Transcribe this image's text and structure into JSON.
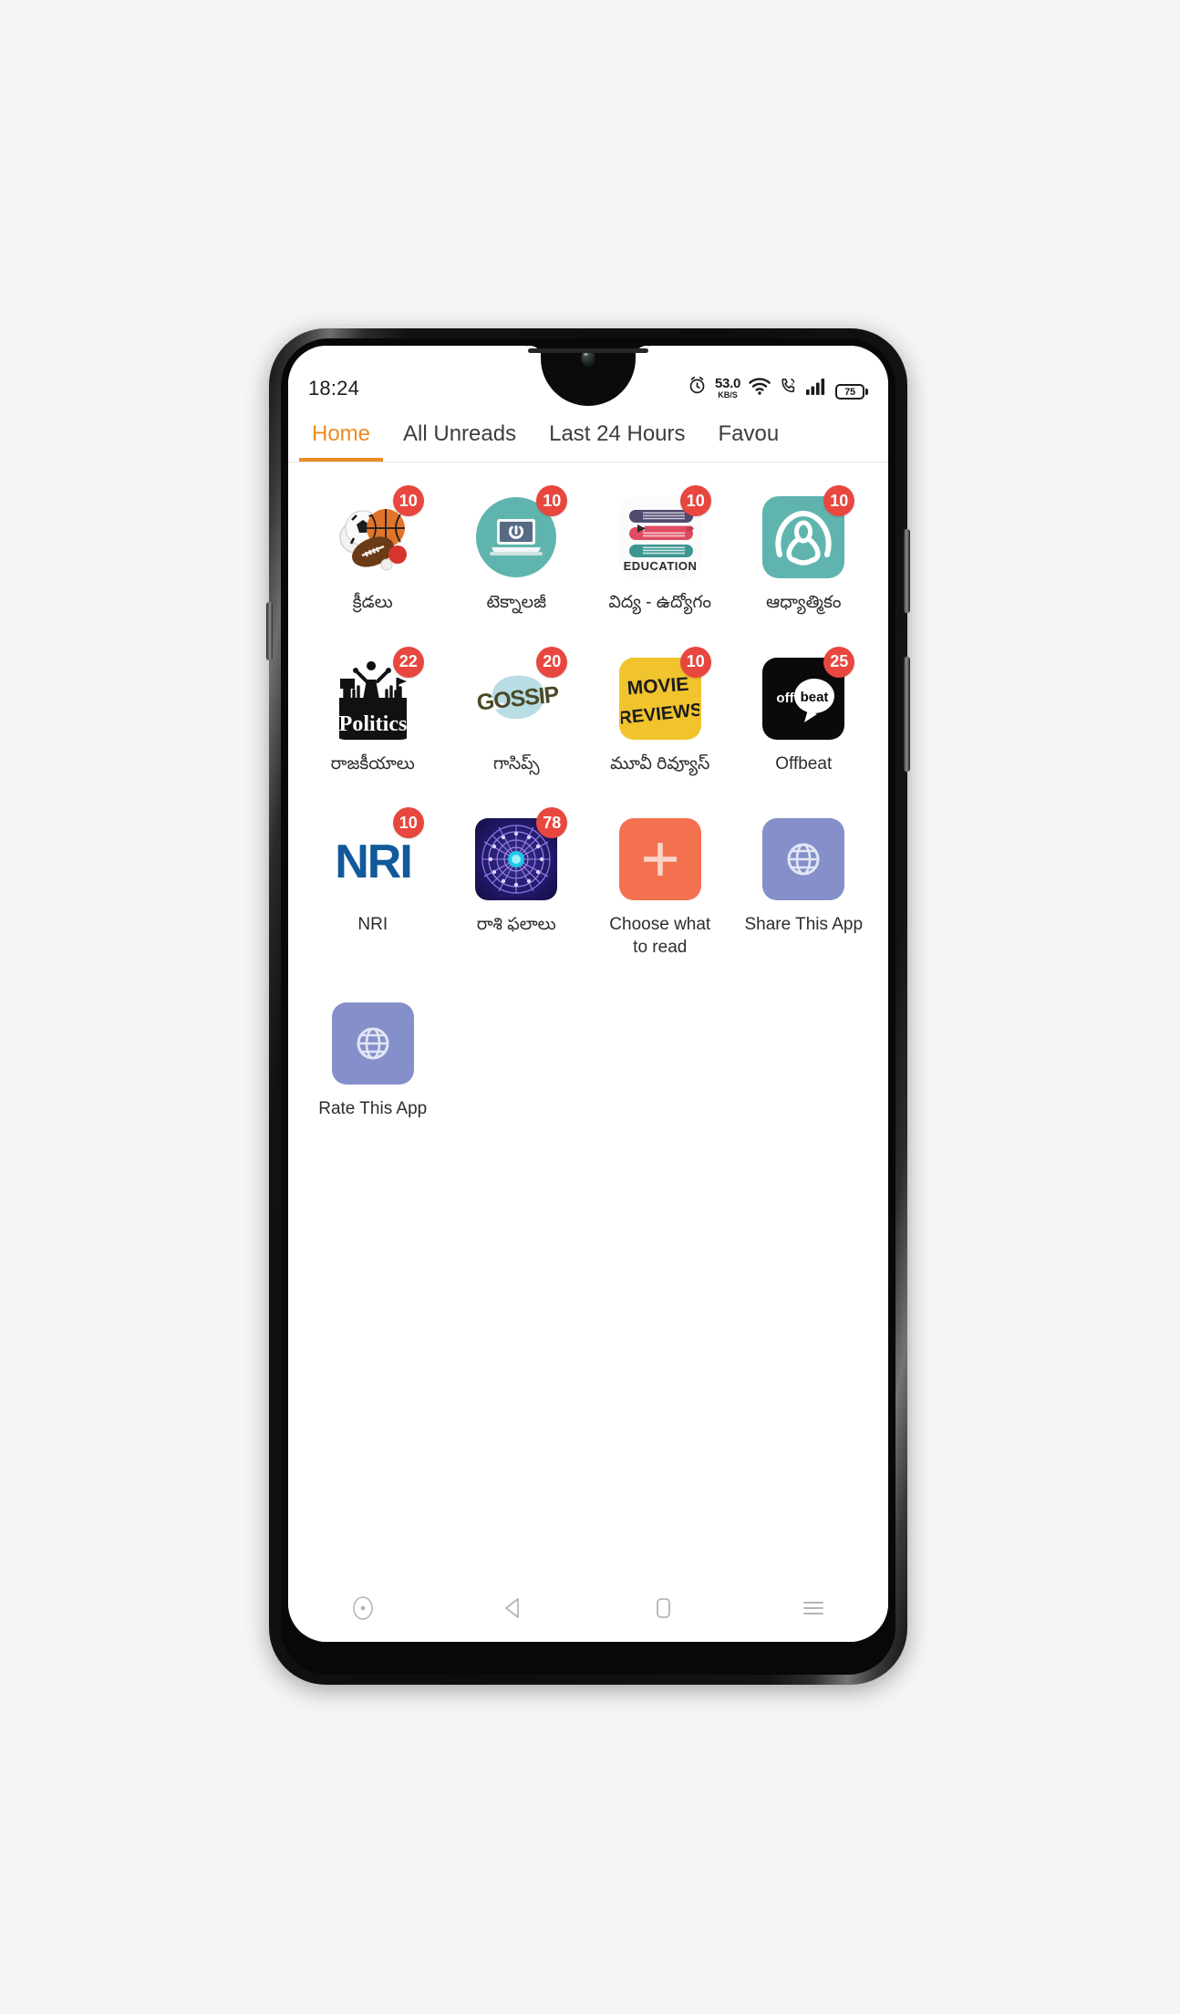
{
  "device": {
    "name": "android-phone-mockup",
    "frame_color": "#111111"
  },
  "status_bar": {
    "time": "18:24",
    "alarm_icon": "alarm-clock-icon",
    "network_speed_value": "53.0",
    "network_speed_unit": "KB/S",
    "wifi_icon": "wifi-icon",
    "call_icon": "phone-call-icon",
    "signal_icon": "cellular-signal-icon",
    "battery_level": "75"
  },
  "tabs": [
    {
      "label": "Home",
      "active": true,
      "name": "tab-home"
    },
    {
      "label": "All Unreads",
      "active": false,
      "name": "tab-all-unreads"
    },
    {
      "label": "Last 24 Hours",
      "active": false,
      "name": "tab-last-24-hours"
    },
    {
      "label": "Favou",
      "active": false,
      "name": "tab-favourites"
    }
  ],
  "colors": {
    "accent": "#eb8c22",
    "badge": "#e8473f",
    "teal": "#5fb5ae",
    "orange_tile": "#f4714f",
    "purple_tile": "#8590ca",
    "yellow_tile": "#f1c42e",
    "nri_blue": "#11599a"
  },
  "apps": [
    {
      "name": "app-sports",
      "label": "క్రీడలు",
      "badge": "10",
      "icon": "sports-balls-icon"
    },
    {
      "name": "app-technology",
      "label": "టెక్నాలజీ",
      "badge": "10",
      "icon": "laptop-power-icon"
    },
    {
      "name": "app-education",
      "label": "విద్య - ఉద్యోగం",
      "badge": "10",
      "icon": "stacked-books-icon"
    },
    {
      "name": "app-spiritual",
      "label": "ఆధ్యాత్మికం",
      "badge": "10",
      "icon": "meditation-icon"
    },
    {
      "name": "app-politics",
      "label": "రాజకీయాలు",
      "badge": "22",
      "icon": "politics-rally-icon"
    },
    {
      "name": "app-gossips",
      "label": "గాసిప్స్",
      "badge": "20",
      "icon": "gossip-icon"
    },
    {
      "name": "app-movie-reviews",
      "label": "మూవీ రివ్యూస్",
      "badge": "10",
      "icon": "movie-reviews-icon"
    },
    {
      "name": "app-offbeat",
      "label": "Offbeat",
      "badge": "25",
      "icon": "offbeat-icon"
    },
    {
      "name": "app-nri",
      "label": "NRI",
      "badge": "10",
      "icon": "nri-icon"
    },
    {
      "name": "app-horoscope",
      "label": "రాశి ఫలాలు",
      "badge": "78",
      "icon": "zodiac-wheel-icon"
    },
    {
      "name": "app-choose-what-to-read",
      "label": "Choose what to read",
      "badge": "",
      "icon": "plus-icon"
    },
    {
      "name": "app-share-this-app",
      "label": "Share This App",
      "badge": "",
      "icon": "globe-icon"
    },
    {
      "name": "app-rate-this-app",
      "label": "Rate This App",
      "badge": "",
      "icon": "globe-icon"
    }
  ],
  "icon_text": {
    "education": "EDUCATION",
    "politics": "Politics",
    "gossip": "GOSSIP",
    "movie_line1": "MOVIE",
    "movie_line2": "REVIEWS",
    "offbeat_left": "off",
    "offbeat_right": "beat",
    "nri": "NRI"
  },
  "nav_bar": {
    "items": [
      {
        "name": "nav-assistant-button",
        "icon": "circle-dot-icon"
      },
      {
        "name": "nav-back-button",
        "icon": "back-triangle-icon"
      },
      {
        "name": "nav-home-button",
        "icon": "home-square-icon"
      },
      {
        "name": "nav-recents-button",
        "icon": "hamburger-menu-icon"
      }
    ]
  }
}
